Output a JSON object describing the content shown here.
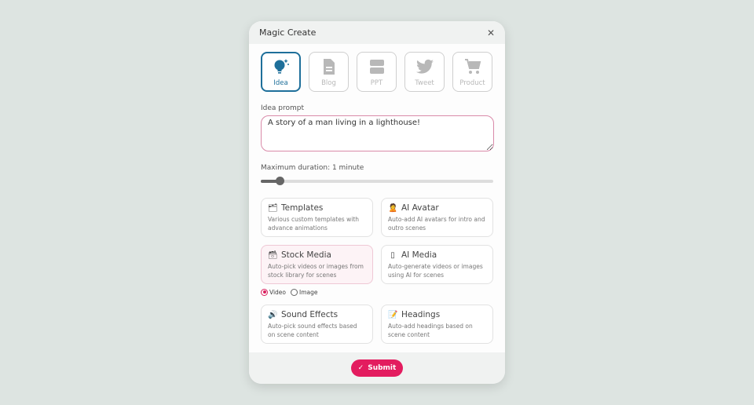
{
  "modal": {
    "title": "Magic Create",
    "close_icon": "close-icon"
  },
  "types": [
    {
      "label": "Idea",
      "icon": "lightbulb-sparkle-icon",
      "active": true
    },
    {
      "label": "Blog",
      "icon": "document-icon",
      "active": false
    },
    {
      "label": "PPT",
      "icon": "slides-icon",
      "active": false
    },
    {
      "label": "Tweet",
      "icon": "twitter-bird-icon",
      "active": false
    },
    {
      "label": "Product",
      "icon": "shopping-cart-icon",
      "active": false
    }
  ],
  "prompt": {
    "label": "Idea prompt",
    "value": "A story of a man living in a lighthouse!"
  },
  "duration": {
    "label": "Maximum duration: 1 minute",
    "value_fraction": 0.08
  },
  "options": [
    {
      "title": "Templates",
      "icon": "🗂",
      "icon_name": "templates-icon",
      "desc": "Various custom templates with advance animations"
    },
    {
      "title": "AI Avatar",
      "icon": "🙎",
      "icon_name": "avatar-icon",
      "desc": "Auto-add AI avatars for intro and outro scenes"
    },
    {
      "title": "Stock Media",
      "icon": "🗃",
      "icon_name": "stock-media-icon",
      "desc": "Auto-pick videos or images from stock library for scenes",
      "selected": true
    },
    {
      "title": "AI Media",
      "icon": "▯",
      "icon_name": "ai-media-icon",
      "desc": "Auto-generate videos or images using AI for scenes"
    },
    {
      "title": "Sound Effects",
      "icon": "🔊",
      "icon_name": "sound-effects-icon",
      "desc": "Auto-pick sound effects based on scene content"
    },
    {
      "title": "Headings",
      "icon": "📝",
      "icon_name": "headings-icon",
      "desc": "Auto-add headings based on scene content"
    }
  ],
  "media_type": {
    "options": [
      "Video",
      "Image"
    ],
    "selected": "Video"
  },
  "footer": {
    "submit_label": "Submit",
    "submit_icon": "checkmark-icon"
  },
  "colors": {
    "accent": "#e31c5f",
    "active_type": "#1e6f9a"
  }
}
